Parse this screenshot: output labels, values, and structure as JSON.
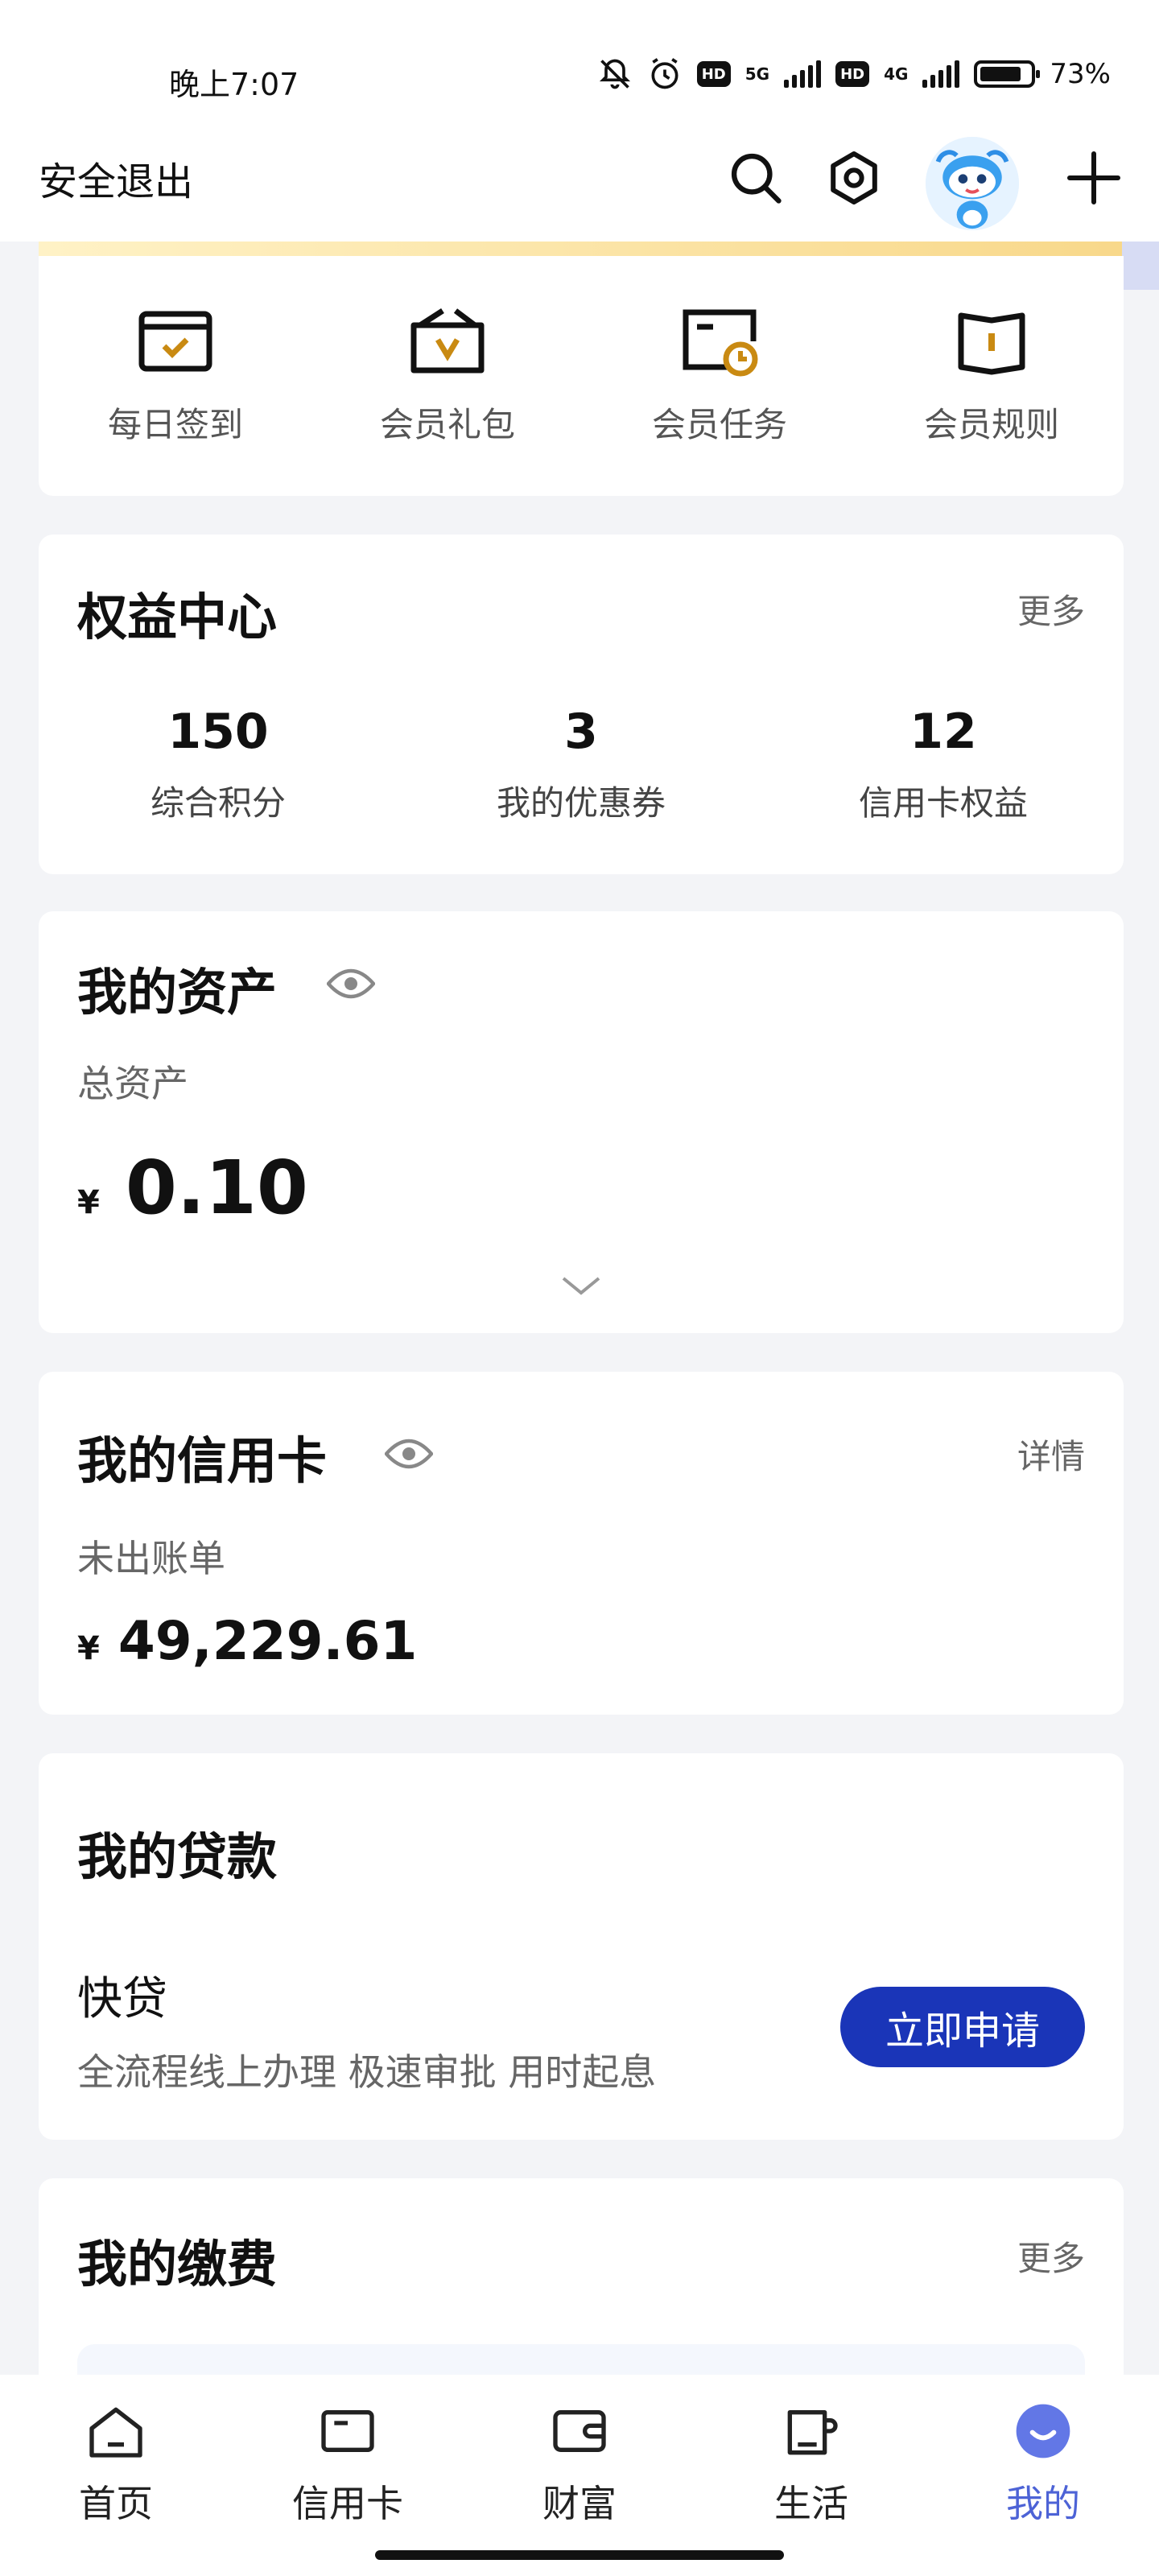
{
  "status_bar": {
    "time": "晚上7:07",
    "net1": "5G",
    "net2": "4G",
    "hd": "HD",
    "battery": "73%"
  },
  "header": {
    "logout": "安全退出",
    "icons": [
      "search-icon",
      "settings-icon",
      "mascot-avatar",
      "plus-icon"
    ]
  },
  "quick_actions": [
    {
      "label": "每日签到",
      "icon": "checkin-icon"
    },
    {
      "label": "会员礼包",
      "icon": "gift-icon"
    },
    {
      "label": "会员任务",
      "icon": "task-icon"
    },
    {
      "label": "会员规则",
      "icon": "rules-icon"
    }
  ],
  "rights": {
    "title": "权益中心",
    "more": "更多",
    "stats": [
      {
        "value": "150",
        "label": "综合积分"
      },
      {
        "value": "3",
        "label": "我的优惠券"
      },
      {
        "value": "12",
        "label": "信用卡权益"
      }
    ]
  },
  "assets": {
    "title": "我的资产",
    "total_label": "总资产",
    "currency": "¥",
    "total": "0.10"
  },
  "credit": {
    "title": "我的信用卡",
    "detail": "详情",
    "bill_label": "未出账单",
    "currency": "¥",
    "amount": "49,229.61"
  },
  "loan": {
    "title": "我的贷款",
    "product": "快贷",
    "desc": "全流程线上办理 极速审批 用时起息",
    "apply": "立即申请"
  },
  "payment": {
    "title": "我的缴费",
    "more": "更多"
  },
  "nav": [
    {
      "label": "首页",
      "icon": "home-icon"
    },
    {
      "label": "信用卡",
      "icon": "card-icon"
    },
    {
      "label": "财富",
      "icon": "wallet-icon"
    },
    {
      "label": "生活",
      "icon": "cup-icon"
    },
    {
      "label": "我的",
      "icon": "me-icon"
    }
  ],
  "colors": {
    "primary": "#1a35b8",
    "active_nav": "#4d63d6",
    "gold": "#c98a12"
  }
}
